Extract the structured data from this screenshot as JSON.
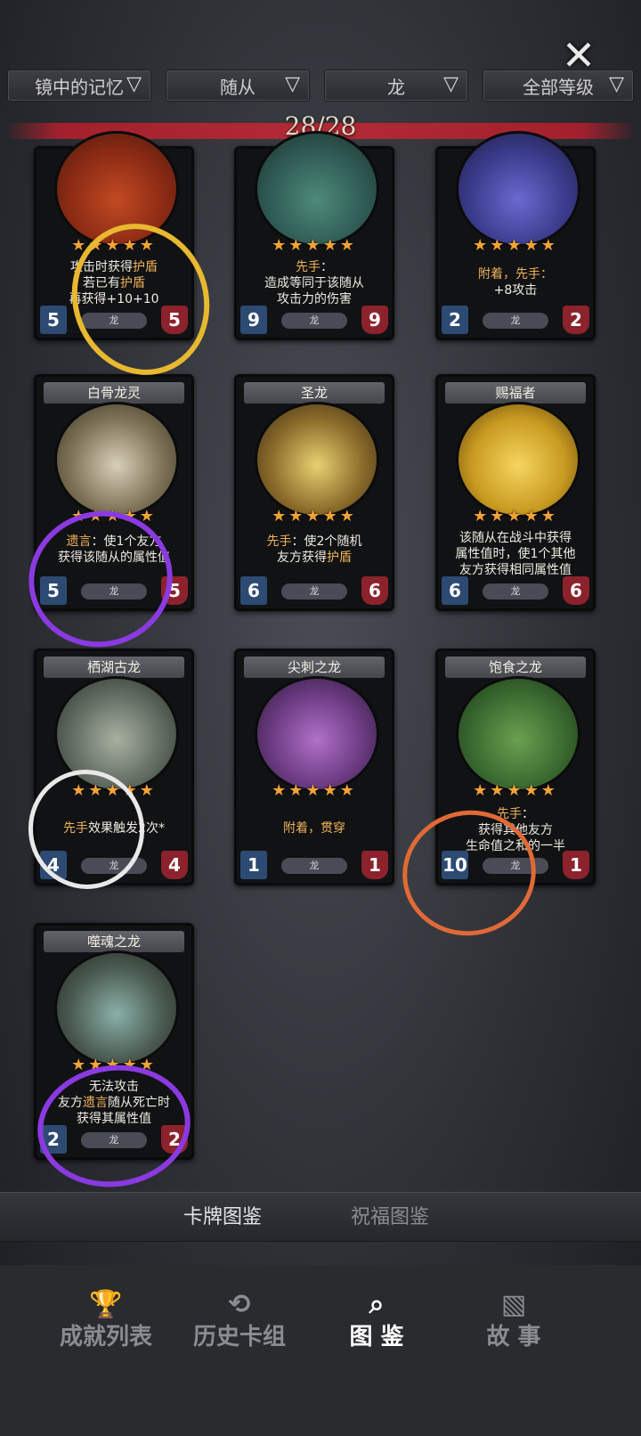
{
  "filters": [
    {
      "label": "镜中的记忆"
    },
    {
      "label": "随从"
    },
    {
      "label": "龙"
    },
    {
      "label": "全部等级"
    }
  ],
  "count": "28/28",
  "stars": "★★★★★",
  "cards": [
    {
      "name": "",
      "desc1": "攻击时获得",
      "desc1b": "护盾",
      "desc2": "若已有",
      "desc2b": "护盾",
      "desc3": "再获得+10+10",
      "tribe": "龙",
      "atk": "5",
      "hp": "5"
    },
    {
      "name": "",
      "desc1": "先手",
      "desc1b": "：",
      "desc2": "造成等同于该随从",
      "desc3": "攻击力的伤害",
      "tribe": "龙",
      "atk": "9",
      "hp": "9"
    },
    {
      "name": "",
      "desc1": "附着，先手",
      "desc1b": "：",
      "desc2": "+8攻击",
      "desc3": "",
      "tribe": "龙",
      "atk": "2",
      "hp": "2"
    },
    {
      "name": "白骨龙灵",
      "desc1": "遗言",
      "desc1b": "：使1个友方",
      "desc2": "获得该随从的属性值",
      "desc3": "",
      "tribe": "龙",
      "atk": "5",
      "hp": "5"
    },
    {
      "name": "圣龙",
      "desc1": "先手",
      "desc1b": "：使2个随机",
      "desc2": "友方获得",
      "desc2b": "护盾",
      "desc3": "",
      "tribe": "龙",
      "atk": "6",
      "hp": "6"
    },
    {
      "name": "赐福者",
      "desc1": "该随从在战斗中获得",
      "desc1b": "",
      "desc2": "属性值时，使1个其他",
      "desc3": "友方获得相同属性值",
      "tribe": "龙",
      "atk": "6",
      "hp": "6"
    },
    {
      "name": "栖湖古龙",
      "desc1": "先手",
      "desc1b": "效果触发2次*",
      "desc2": "",
      "desc3": "",
      "tribe": "龙",
      "atk": "4",
      "hp": "4"
    },
    {
      "name": "尖刺之龙",
      "desc1": "附着，贯穿",
      "desc1b": "",
      "desc2": "",
      "desc3": "",
      "tribe": "龙",
      "atk": "1",
      "hp": "1"
    },
    {
      "name": "饱食之龙",
      "desc1": "先手",
      "desc1b": "：",
      "desc2": "获得其他友方",
      "desc3": "生命值之和的一半",
      "tribe": "龙",
      "atk": "10",
      "hp": "1"
    },
    {
      "name": "噬魂之龙",
      "desc1": "无法攻击",
      "desc1b": "",
      "desc2": "友方",
      "desc2b": "遗言",
      "desc2c": "随从死亡时",
      "desc3": "获得其属性值",
      "tribe": "龙",
      "atk": "2",
      "hp": "2"
    }
  ],
  "categories": {
    "cards": "卡牌图鉴",
    "blessings": "祝福图鉴"
  },
  "nav": [
    {
      "label": "成就列表",
      "icon": "trophy-icon"
    },
    {
      "label": "历史卡组",
      "icon": "history-icon"
    },
    {
      "label": "图 鉴",
      "icon": "magnifier-icon"
    },
    {
      "label": "故 事",
      "icon": "book-icon"
    }
  ],
  "colors": {
    "accent": "#f0b35a",
    "red_bar": "#b42a35",
    "atk": "#2d4a73",
    "hp": "#8c222c",
    "star": "#f3a436"
  }
}
